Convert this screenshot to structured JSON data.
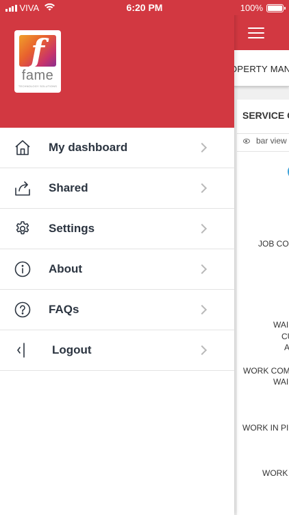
{
  "status_bar": {
    "carrier": "VIVA",
    "time": "6:20 PM",
    "battery": "100%",
    "battery_level": 1.0
  },
  "drawer": {
    "logo": {
      "name": "fame",
      "tagline": "TECHNOLOGY SOLUTIONS",
      "brand_gradient": [
        "#f0a02a",
        "#e8612e",
        "#c8336b",
        "#8a2f8e"
      ]
    },
    "header_color": "#d23841",
    "items": [
      {
        "label": "My dashboard",
        "icon": "home-icon"
      },
      {
        "label": "Shared",
        "icon": "share-icon"
      },
      {
        "label": "Settings",
        "icon": "gear-icon"
      },
      {
        "label": "About",
        "icon": "info-icon"
      },
      {
        "label": "FAQs",
        "icon": "question-icon"
      },
      {
        "label": "Logout",
        "icon": "logout-icon"
      }
    ]
  },
  "background": {
    "tab_text": "OPERTY MAN",
    "card_title": "SERVICE C",
    "bar_view": "bar view",
    "labels": [
      {
        "line1": "JOB CO"
      },
      {
        "line1": "WAI",
        "line2": "CU",
        "line3": "A"
      },
      {
        "line1": "WORK COM",
        "line2": "WAI"
      },
      {
        "line1": "WORK IN PI"
      },
      {
        "line1": "WORK"
      }
    ]
  }
}
